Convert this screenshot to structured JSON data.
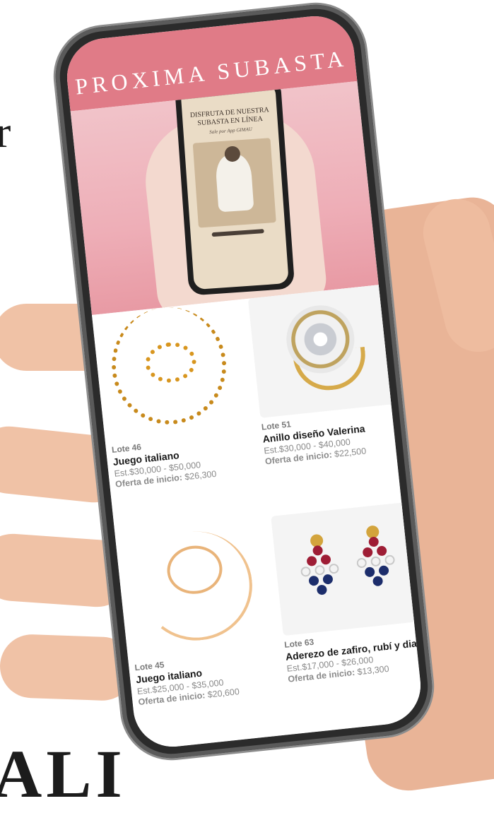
{
  "background": {
    "partial_letter_left": "r",
    "partial_text_bottom": "ALI"
  },
  "header": {
    "title": "PROXIMA SUBASTA",
    "color": "#e07b87"
  },
  "hero": {
    "mini_title": "DISFRUTA DE NUESTRA SUBASTA EN LÍNEA",
    "mini_subtitle": "Sale por App GIMAU"
  },
  "products": [
    {
      "lot": "Lote 46",
      "name": "Juego italiano",
      "estimate": "Est.$30,000 - $50,000",
      "start_label": "Oferta de inicio:",
      "start_value": "$26,300",
      "image": "gold-chain-bracelet-set"
    },
    {
      "lot": "Lote 51",
      "name": "Anillo diseño Valerina",
      "estimate": "Est.$30,000 - $40,000",
      "start_label": "Oferta de inicio:",
      "start_value": "$22,500",
      "image": "diamond-ring"
    },
    {
      "lot": "Lote 45",
      "name": "Juego italiano",
      "estimate": "Est.$25,000 - $35,000",
      "start_label": "Oferta de inicio:",
      "start_value": "$20,600",
      "image": "multi-strand-necklace-set"
    },
    {
      "lot": "Lote 63",
      "name": "Aderezo de zafiro, rubí y dia...",
      "estimate": "Est.$17,000 - $26,000",
      "start_label": "Oferta de inicio:",
      "start_value": "$13,300",
      "image": "sapphire-ruby-earrings"
    }
  ]
}
